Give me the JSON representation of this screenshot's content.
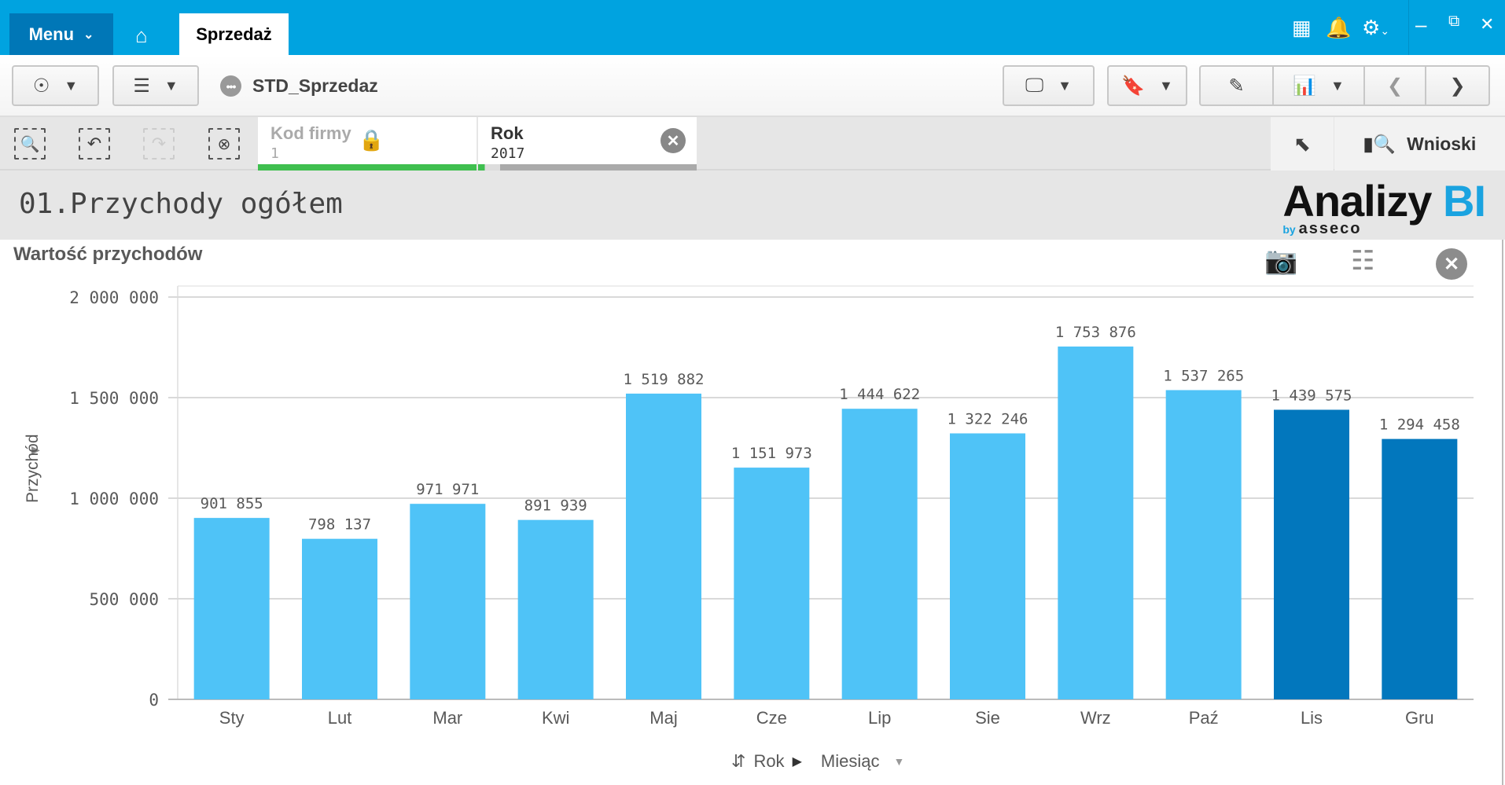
{
  "topbar": {
    "menu_label": "Menu",
    "active_tab": "Sprzedaż",
    "icons": [
      "home-icon",
      "grid-icon",
      "bell-icon",
      "gear-icon",
      "minimize-icon",
      "restore-icon",
      "close-icon"
    ]
  },
  "toolbar": {
    "app_name": "STD_Sprzedaz"
  },
  "selections": [
    {
      "field": "Kod firmy",
      "value": "1",
      "locked": true
    },
    {
      "field": "Rok",
      "value": "2017"
    }
  ],
  "insights_label": "Wnioski",
  "sheet_title": "01.Przychody ogółem",
  "logo": {
    "main": "Analizy ",
    "accent": "BI",
    "by": "by",
    "brand": "asseco"
  },
  "colors": {
    "topbar": "#00a3e0",
    "bar": "#4fc3f7",
    "bar_selected": "#0277bd",
    "green": "#3fbf4f"
  },
  "chart_data": {
    "type": "bar",
    "title": "Wartość przychodów",
    "xlabel": "",
    "ylabel": "Przychód",
    "ylim": [
      0,
      2000000
    ],
    "yticks": [
      0,
      500000,
      1000000,
      1500000,
      2000000
    ],
    "ytick_labels": [
      "0",
      "500 000",
      "1 000 000",
      "1 500 000",
      "2 000 000"
    ],
    "categories": [
      "Sty",
      "Lut",
      "Mar",
      "Kwi",
      "Maj",
      "Cze",
      "Lip",
      "Sie",
      "Wrz",
      "Paź",
      "Lis",
      "Gru"
    ],
    "values": [
      901855,
      798137,
      971971,
      891939,
      1519882,
      1151973,
      1444622,
      1322246,
      1753876,
      1537265,
      1439575,
      1294458
    ],
    "value_labels": [
      "901 855",
      "798 137",
      "971 971",
      "891 939",
      "1 519 882",
      "1 151 973",
      "1 444 622",
      "1 322 246",
      "1 753 876",
      "1 537 265",
      "1 439 575",
      "1 294 458"
    ],
    "highlighted": [
      "Lis",
      "Gru"
    ],
    "grid": true
  },
  "drill": {
    "level1": "Rok",
    "level2": "Miesiąc"
  }
}
